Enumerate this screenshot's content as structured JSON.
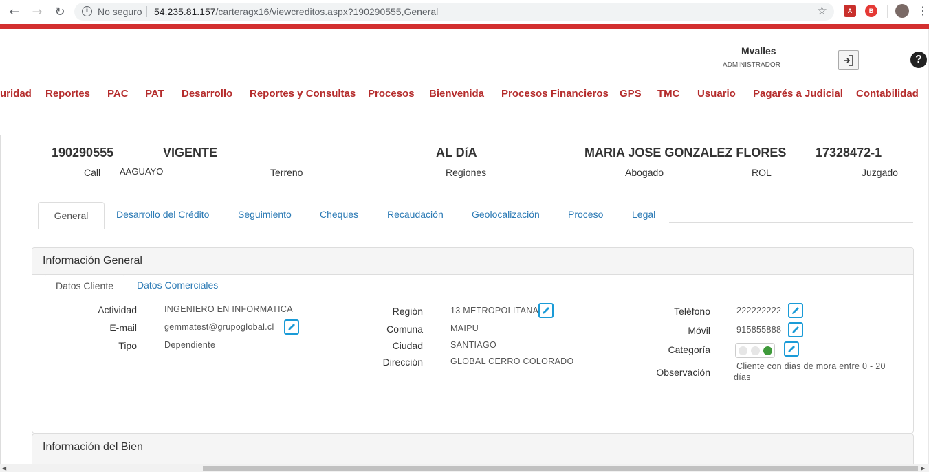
{
  "browser": {
    "security_label": "No seguro",
    "url_host": "54.235.81.157",
    "url_path": "/carteragx16/viewcreditos.aspx?190290555,General"
  },
  "user": {
    "name": "Mvalles",
    "role": "ADMINISTRADOR"
  },
  "menu": [
    "uridad",
    "Reportes",
    "PAC",
    "PAT",
    "Desarrollo",
    "Reportes y Consultas",
    "Procesos",
    "Bienvenida",
    "Procesos Financieros",
    "GPS",
    "TMC",
    "Usuario",
    "Pagarés a Judicial",
    "Contabilidad"
  ],
  "credit": {
    "number": "190290555",
    "status": "VIGENTE",
    "payment_state": "AL DíA",
    "client_name": "MARIA JOSE GONZALEZ FLORES",
    "rut": "17328472-1",
    "call_label": "Call",
    "call_value": "AAGUAYO",
    "terreno_label": "Terreno",
    "regiones_label": "Regiones",
    "abogado_label": "Abogado",
    "rol_label": "ROL",
    "juzgado_label": "Juzgado"
  },
  "tabs": [
    "General",
    "Desarrollo del Crédito",
    "Seguimiento",
    "Cheques",
    "Recaudación",
    "Geolocalización",
    "Proceso",
    "Legal"
  ],
  "general_panel": {
    "title": "Información General",
    "subtabs": [
      "Datos Cliente",
      "Datos Comerciales"
    ],
    "fields": {
      "actividad_label": "Actividad",
      "actividad": "INGENIERO EN INFORMATICA",
      "email_label": "E-mail",
      "email": "gemmatest@grupoglobal.cl",
      "tipo_label": "Tipo",
      "tipo": "Dependiente",
      "region_label": "Región",
      "region": "13 METROPOLITANA",
      "comuna_label": "Comuna",
      "comuna": "MAIPU",
      "ciudad_label": "Ciudad",
      "ciudad": "SANTIAGO",
      "direccion_label": "Dirección",
      "direccion": "GLOBAL CERRO COLORADO",
      "telefono_label": "Teléfono",
      "telefono": "222222222",
      "movil_label": "Móvil",
      "movil": "915855888",
      "categoria_label": "Categoría",
      "observacion_label": "Observación",
      "observacion_line1": "Cliente con dias de mora entre 0 - 20",
      "observacion_line2": "días"
    },
    "category_colors": [
      "#e6e6e6",
      "#e6e6e6",
      "#3f9a3b"
    ]
  },
  "bien_panel": {
    "title": "Información del Bien"
  },
  "colors": {
    "brand_red": "#d32f2f",
    "menu_text": "#b52d2d",
    "link_blue": "#2b7ab5",
    "edit_blue": "#1a9bd7"
  }
}
